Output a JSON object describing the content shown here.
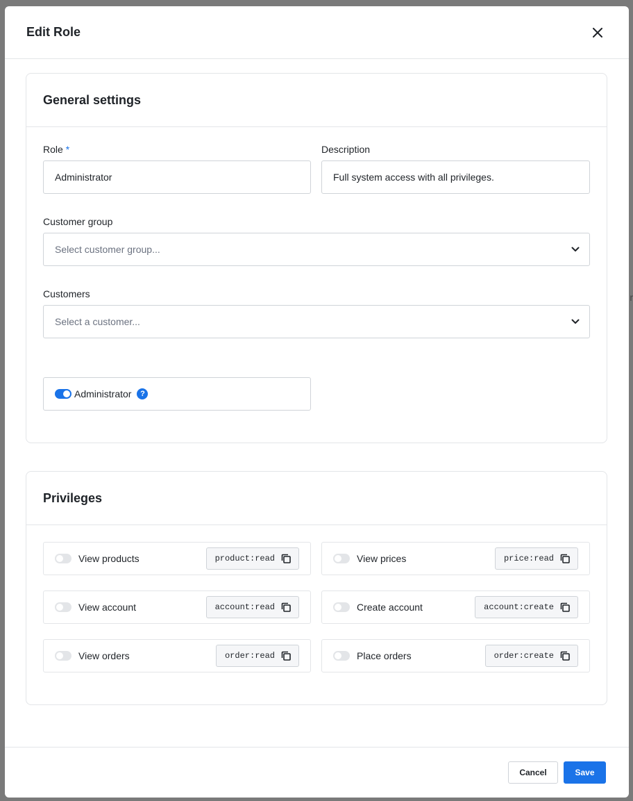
{
  "backdrop": {
    "edge_text": "r"
  },
  "modal": {
    "title": "Edit Role"
  },
  "general": {
    "title": "General settings",
    "role_label": "Role",
    "role_required": "*",
    "role_value": "Administrator",
    "description_label": "Description",
    "description_value": "Full system access with all privileges.",
    "customer_group_label": "Customer group",
    "customer_group_placeholder": "Select customer group...",
    "customers_label": "Customers",
    "customers_placeholder": "Select a customer...",
    "admin_label": "Administrator",
    "admin_enabled": true,
    "help_glyph": "?"
  },
  "privileges": {
    "title": "Privileges",
    "items": [
      {
        "label": "View products",
        "code": "product:read",
        "enabled": false
      },
      {
        "label": "View prices",
        "code": "price:read",
        "enabled": false
      },
      {
        "label": "View account",
        "code": "account:read",
        "enabled": false
      },
      {
        "label": "Create account",
        "code": "account:create",
        "enabled": false
      },
      {
        "label": "View orders",
        "code": "order:read",
        "enabled": false
      },
      {
        "label": "Place orders",
        "code": "order:create",
        "enabled": false
      }
    ]
  },
  "footer": {
    "cancel_label": "Cancel",
    "save_label": "Save"
  },
  "colors": {
    "accent": "#1a73e8",
    "border": "#e3e5e8",
    "toggle_off": "#e3e5e8"
  },
  "icons": [
    "close-icon",
    "chevron-down-icon",
    "help-icon",
    "copy-icon"
  ]
}
